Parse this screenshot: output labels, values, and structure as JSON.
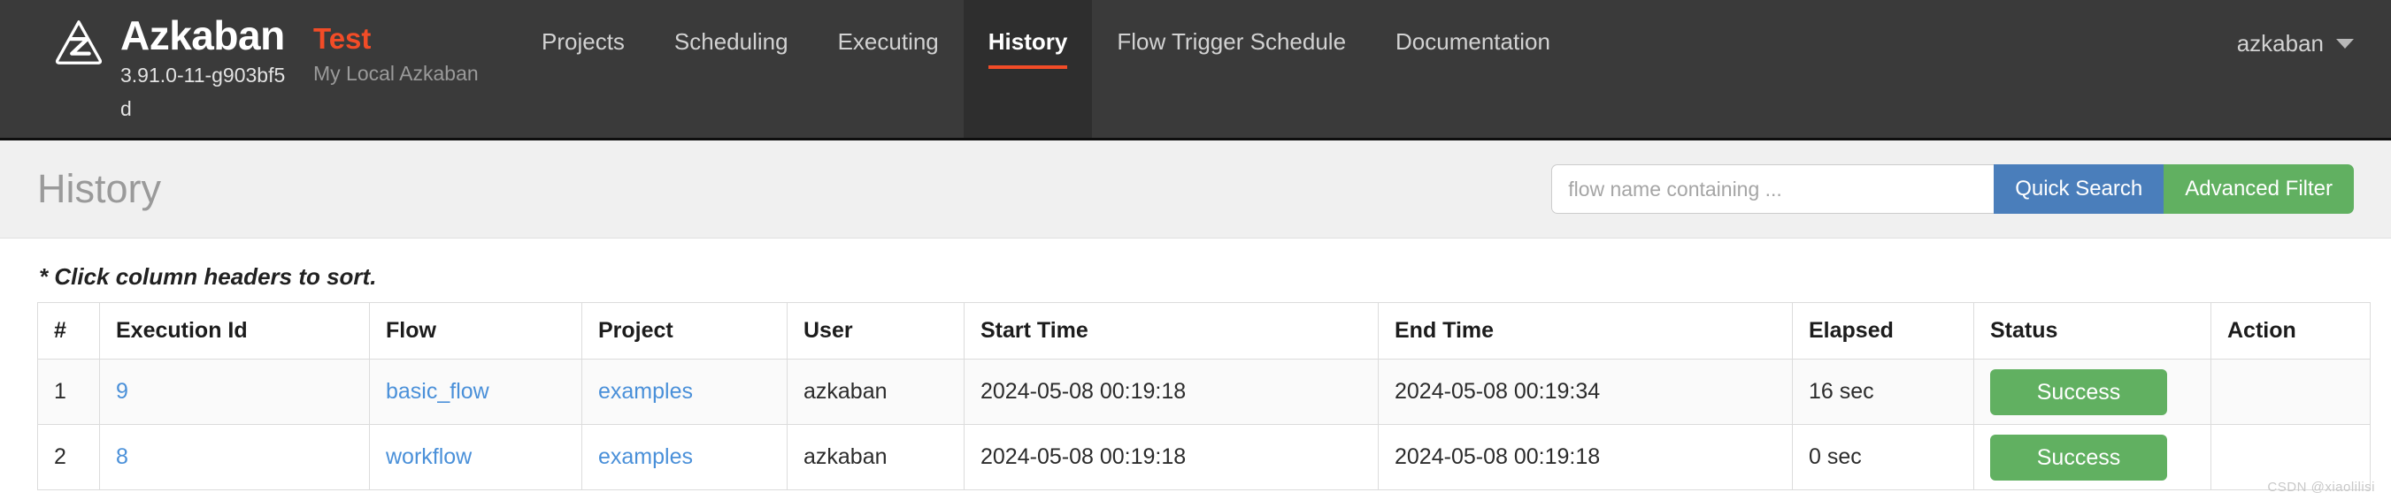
{
  "navbar": {
    "brand_name": "Azkaban",
    "version": "3.91.0-11-g903bf5d",
    "instance_title": "Test",
    "instance_subtitle": "My Local Azkaban",
    "links": [
      {
        "label": "Projects",
        "active": false
      },
      {
        "label": "Scheduling",
        "active": false
      },
      {
        "label": "Executing",
        "active": false
      },
      {
        "label": "History",
        "active": true
      },
      {
        "label": "Flow Trigger Schedule",
        "active": false
      },
      {
        "label": "Documentation",
        "active": false
      }
    ],
    "user": "azkaban",
    "caret_icon": "chevron-down-icon",
    "accent_color": "#f24c27",
    "background_color": "#3a3a3a"
  },
  "page_header": {
    "title": "History",
    "search_placeholder": "flow name containing ...",
    "search_value": "",
    "quick_search_label": "Quick Search",
    "advanced_filter_label": "Advanced Filter",
    "quick_search_color": "#4a7ebb",
    "advanced_filter_color": "#61b061"
  },
  "main": {
    "sort_note": "* Click column headers to sort.",
    "table": {
      "columns": [
        "#",
        "Execution Id",
        "Flow",
        "Project",
        "User",
        "Start Time",
        "End Time",
        "Elapsed",
        "Status",
        "Action"
      ],
      "rows": [
        {
          "num": "1",
          "execution_id": "9",
          "flow": "basic_flow",
          "project": "examples",
          "user": "azkaban",
          "start_time": "2024-05-08 00:19:18",
          "end_time": "2024-05-08 00:19:34",
          "elapsed": "16 sec",
          "status": "Success",
          "status_color": "#61b061",
          "action": ""
        },
        {
          "num": "2",
          "execution_id": "8",
          "flow": "workflow",
          "project": "examples",
          "user": "azkaban",
          "start_time": "2024-05-08 00:19:18",
          "end_time": "2024-05-08 00:19:18",
          "elapsed": "0 sec",
          "status": "Success",
          "status_color": "#61b061",
          "action": ""
        }
      ]
    }
  },
  "watermark": "CSDN @xiaolilisi"
}
